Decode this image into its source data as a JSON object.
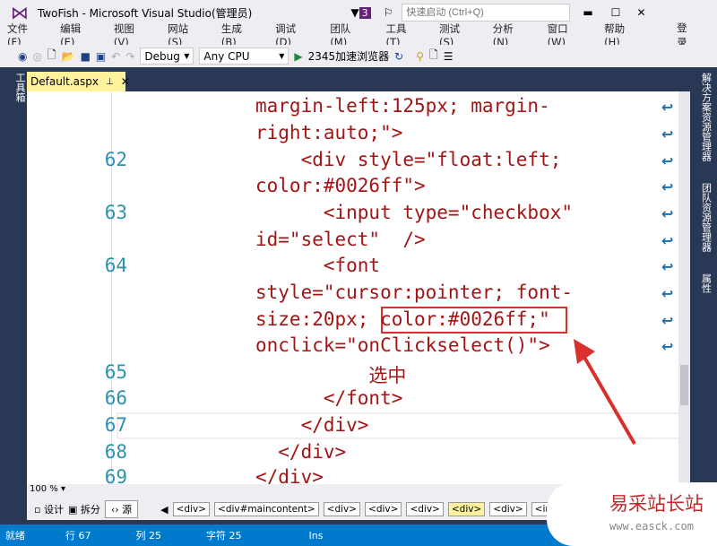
{
  "window": {
    "title": "TwoFish - Microsoft Visual Studio(管理员)",
    "notification_count": "3",
    "quick_launch_placeholder": "快速启动 (Ctrl+Q)"
  },
  "menu": [
    "文件(F)",
    "编辑(E)",
    "视图(V)",
    "网站(S)",
    "生成(B)",
    "调试(D)",
    "团队(M)",
    "工具(T)",
    "测试(S)",
    "分析(N)",
    "窗口(W)",
    "帮助(H)"
  ],
  "login": "登录",
  "toolbar": {
    "config": "Debug",
    "platform": "Any CPU",
    "browser": "2345加速浏览器"
  },
  "tab": {
    "label": "Default.aspx"
  },
  "side": {
    "left": "工具箱",
    "right": [
      "解决方案资源管理器",
      "团队资源管理器",
      "属性"
    ]
  },
  "code_lines": [
    {
      "num": "",
      "text": "margin-left:125px; margin-"
    },
    {
      "num": "",
      "text": "right:auto;\">"
    },
    {
      "num": "62",
      "text": "    <div style=\"float:left;"
    },
    {
      "num": "",
      "text": "color:#0026ff\">"
    },
    {
      "num": "63",
      "text": "      <input type=\"checkbox\""
    },
    {
      "num": "",
      "text": "id=\"select\"  />"
    },
    {
      "num": "64",
      "text": "      <font"
    },
    {
      "num": "",
      "text": "style=\"cursor:pointer; font-"
    },
    {
      "num": "",
      "text": "size:20px; color:#0026ff;\""
    },
    {
      "num": "",
      "text": "onclick=\"onClickselect()\">"
    },
    {
      "num": "65",
      "text": "          选中"
    },
    {
      "num": "66",
      "text": "      </font>"
    },
    {
      "num": "67",
      "text": "    </div>"
    },
    {
      "num": "68",
      "text": "  </div>"
    },
    {
      "num": "69",
      "text": "</div>"
    }
  ],
  "zoom": "100 %",
  "views": [
    "设计",
    "拆分",
    "源"
  ],
  "breadcrumbs": [
    "<div>",
    "<div#maincontent>",
    "<div>",
    "<div>",
    "<div>",
    "<div>",
    "<div>",
    "<inpu"
  ],
  "status": {
    "ready": "就绪",
    "line": "行 67",
    "col": "列 25",
    "char": "字符 25",
    "mode": "Ins"
  },
  "watermark": {
    "name": "易采站长站",
    "url": "www.easck.com"
  },
  "colors": {
    "accent": "#007acc",
    "tab": "#fff29d",
    "highlight_box": "#d9302b"
  }
}
